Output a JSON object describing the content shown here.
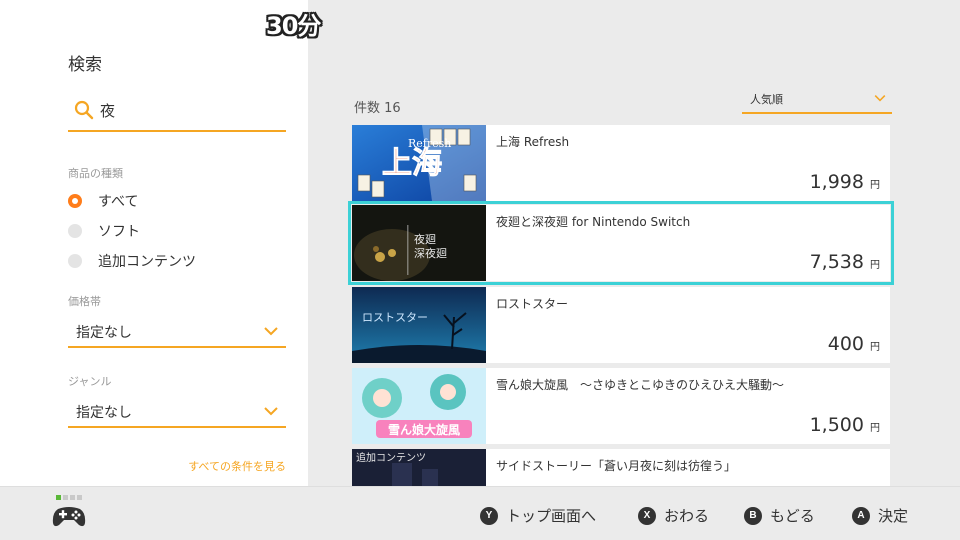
{
  "overlay": {
    "time": "30分"
  },
  "sidebar": {
    "title": "検索",
    "search_value": "夜",
    "product_type_label": "商品の種類",
    "product_types": [
      {
        "label": "すべて",
        "selected": true
      },
      {
        "label": "ソフト",
        "selected": false
      },
      {
        "label": "追加コンテンツ",
        "selected": false
      }
    ],
    "price_label": "価格帯",
    "price_value": "指定なし",
    "genre_label": "ジャンル",
    "genre_value": "指定なし",
    "see_all": "すべての条件を見る"
  },
  "results": {
    "count_label": "件数 16",
    "sort_value": "人気順",
    "items": [
      {
        "title": "上海 Refresh",
        "price": "1,998",
        "unit": "円"
      },
      {
        "title": "夜廻と深夜廻 for Nintendo Switch",
        "price": "7,538",
        "unit": "円"
      },
      {
        "title": "ロストスター",
        "price": "400",
        "unit": "円"
      },
      {
        "title": "雪ん娘大旋風　～さゆきとこゆきのひえひえ大騒動～",
        "price": "1,500",
        "unit": "円"
      },
      {
        "title": "サイドストーリー「蒼い月夜に刻は彷徨う」",
        "price": "",
        "unit": ""
      }
    ],
    "thumb_texts": {
      "shanghai": "上海",
      "shanghai_sub": "Refresh",
      "yomawari": "夜廻\n深夜廻",
      "loststar": "ロストスター",
      "yukinko": "雪ん娘大旋風",
      "dlc": "追加コンテンツ"
    }
  },
  "footer": {
    "buttons": [
      {
        "key": "Y",
        "label": "トップ画面へ"
      },
      {
        "key": "X",
        "label": "おわる"
      },
      {
        "key": "B",
        "label": "もどる"
      },
      {
        "key": "A",
        "label": "決定"
      }
    ]
  },
  "colors": {
    "accent": "#f5a623",
    "radio_selected": "#ff7d1a",
    "focus": "#3cd1d6"
  }
}
